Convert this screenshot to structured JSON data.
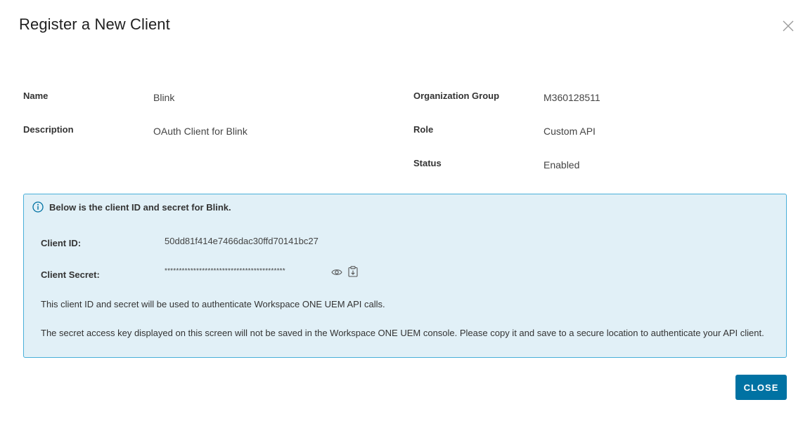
{
  "dialog": {
    "title": "Register a New Client",
    "close_icon": "close-icon"
  },
  "details": {
    "name_label": "Name",
    "name_value": "Blink",
    "description_label": "Description",
    "description_value": "OAuth Client for Blink",
    "org_group_label": "Organization Group",
    "org_group_value": "M360128511",
    "role_label": "Role",
    "role_value": "Custom API",
    "status_label": "Status",
    "status_value": "Enabled"
  },
  "info_box": {
    "icon": "info-icon",
    "heading": "Below is the client ID and secret for Blink.",
    "client_id_label": "Client ID:",
    "client_id_value": "50dd81f414e7466dac30ffd70141bc27",
    "client_secret_label": "Client Secret:",
    "client_secret_value": "******************************************",
    "show_secret_icon": "eye-icon",
    "copy_secret_icon": "copy-icon",
    "note_1": "This client ID and secret will be used to authenticate Workspace ONE UEM API calls.",
    "note_2": "The secret access key displayed on this screen will not be saved in the Workspace ONE UEM console. Please copy it and save to a secure location to authenticate your API client."
  },
  "footer": {
    "close_label": "CLOSE"
  },
  "colors": {
    "primary_button": "#0072a3",
    "info_background": "#e1f0f7",
    "info_border": "#49afd9"
  }
}
